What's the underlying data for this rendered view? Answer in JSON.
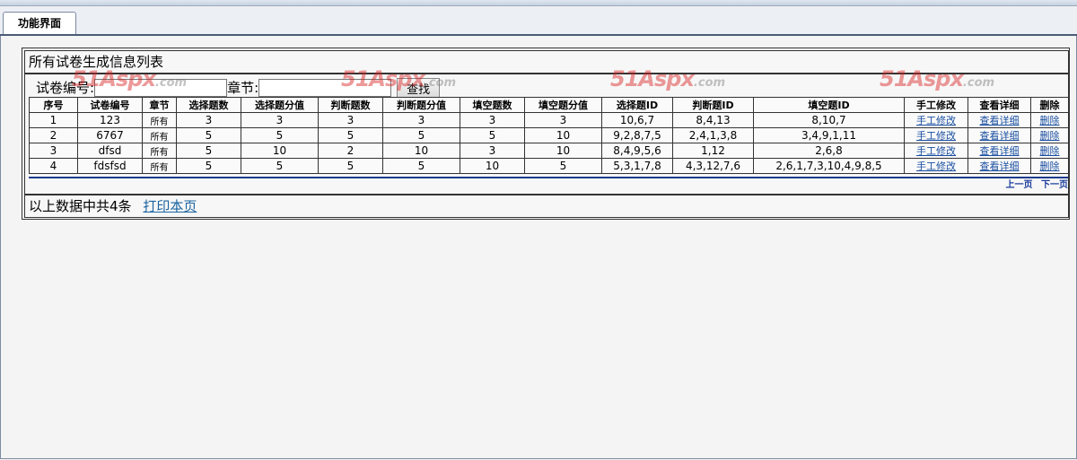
{
  "tab": {
    "label": "功能界面"
  },
  "panel": {
    "title": "所有试卷生成信息列表",
    "search": {
      "paper_label": "试卷编号:",
      "chapter_label": "章节:",
      "paper_value": "",
      "chapter_value": "",
      "button_label": "查找"
    },
    "table": {
      "headers": [
        "序号",
        "试卷编号",
        "章节",
        "选择题数",
        "选择题分值",
        "判断题数",
        "判断题分值",
        "填空题数",
        "填空题分值",
        "选择题ID",
        "判断题ID",
        "填空题ID",
        "手工修改",
        "查看详细",
        "删除"
      ],
      "rows": [
        [
          "1",
          "123",
          "所有",
          "3",
          "3",
          "3",
          "3",
          "3",
          "3",
          "10,6,7",
          "8,4,13",
          "8,10,7",
          "手工修改",
          "查看详细",
          "删除"
        ],
        [
          "2",
          "6767",
          "所有",
          "5",
          "5",
          "5",
          "5",
          "5",
          "10",
          "9,2,8,7,5",
          "2,4,1,3,8",
          "3,4,9,1,11",
          "手工修改",
          "查看详细",
          "删除"
        ],
        [
          "3",
          "dfsd",
          "所有",
          "5",
          "10",
          "2",
          "10",
          "3",
          "10",
          "8,4,9,5,6",
          "1,12",
          "2,6,8",
          "手工修改",
          "查看详细",
          "删除"
        ],
        [
          "4",
          "fdsfsd",
          "所有",
          "5",
          "5",
          "5",
          "5",
          "10",
          "5",
          "5,3,1,7,8",
          "4,3,12,7,6",
          "2,6,1,7,3,10,4,9,8,5",
          "手工修改",
          "查看详细",
          "删除"
        ]
      ]
    },
    "pager": {
      "prev": "上一页",
      "next": "下一页"
    },
    "footer": {
      "summary": "以上数据中共4条",
      "print_link": "打印本页"
    }
  },
  "watermark": {
    "brand": "51Aspx",
    "suffix": ".com"
  }
}
